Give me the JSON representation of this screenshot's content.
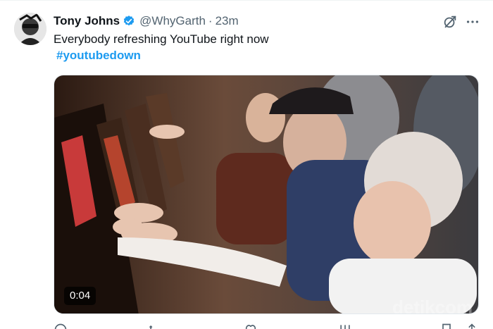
{
  "tweet": {
    "author_name": "Tony Johns",
    "handle": "@WhyGarth",
    "separator": "·",
    "time": "23m",
    "text": "Everybody refreshing YouTube right now",
    "hashtag": "#youtubedown"
  },
  "media": {
    "duration": "0:04",
    "watermark": "detikcom"
  },
  "icons": {
    "verified": "verified-badge-icon",
    "grok": "grok-icon",
    "more": "more-options-icon",
    "reply": "reply-icon",
    "retweet": "retweet-icon",
    "like": "like-icon",
    "views": "views-icon",
    "bookmark": "bookmark-icon",
    "share": "share-icon"
  },
  "colors": {
    "accent": "#1d9bf0",
    "text": "#0f1419",
    "secondary": "#536471"
  }
}
